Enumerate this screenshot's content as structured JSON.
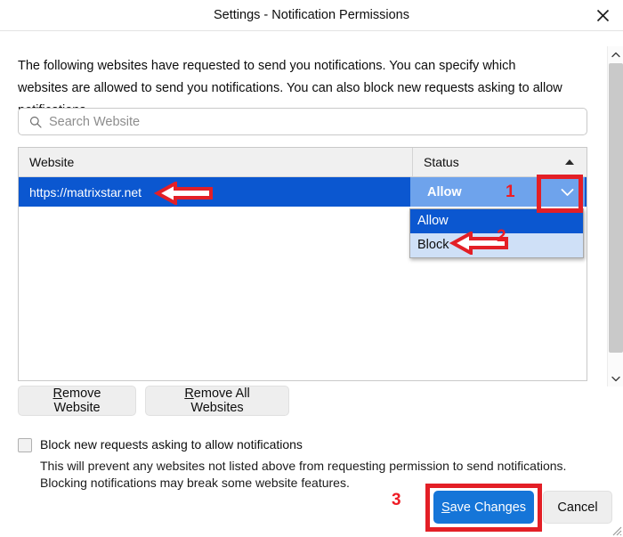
{
  "window": {
    "title": "Settings - Notification Permissions",
    "close_icon": "close-icon"
  },
  "description": "The following websites have requested to send you notifications. You can specify which websites are allowed to send you notifications. You can also block new requests asking to allow notifications.",
  "search": {
    "placeholder": "Search Website",
    "value": "",
    "icon": "search-icon"
  },
  "table": {
    "columns": {
      "website": "Website",
      "status": "Status"
    },
    "sort_icon": "sort-ascending-arrow-icon",
    "rows": [
      {
        "website": "https://matrixstar.net",
        "status": "Allow",
        "selected": true
      }
    ]
  },
  "status_dropdown": {
    "selected": "Allow",
    "chevron_icon": "chevron-down-icon",
    "open": true,
    "options": [
      {
        "label": "Allow",
        "highlighted": true
      },
      {
        "label": "Block",
        "highlighted": false
      }
    ]
  },
  "buttons": {
    "remove_website": "Remove Website",
    "remove_website_accesskey": "R",
    "remove_all_websites": "Remove All Websites",
    "remove_all_websites_accesskey": "R",
    "save_changes": "Save Changes",
    "save_changes_accesskey": "S",
    "cancel": "Cancel"
  },
  "block_new": {
    "checked": false,
    "label": "Block new requests asking to allow notifications",
    "help": "This will prevent any websites not listed above from requesting permission to send notifications. Blocking notifications may break some website features."
  },
  "annotations": {
    "markers": [
      {
        "id": "1",
        "text": "1"
      },
      {
        "id": "2",
        "text": "2"
      },
      {
        "id": "3",
        "text": "3"
      }
    ],
    "color": "#ee1c25"
  },
  "scrollbar": {
    "up_icon": "scroll-up-arrow-icon",
    "down_icon": "scroll-down-arrow-icon"
  },
  "resize_grip_icon": "resize-grip-icon"
}
